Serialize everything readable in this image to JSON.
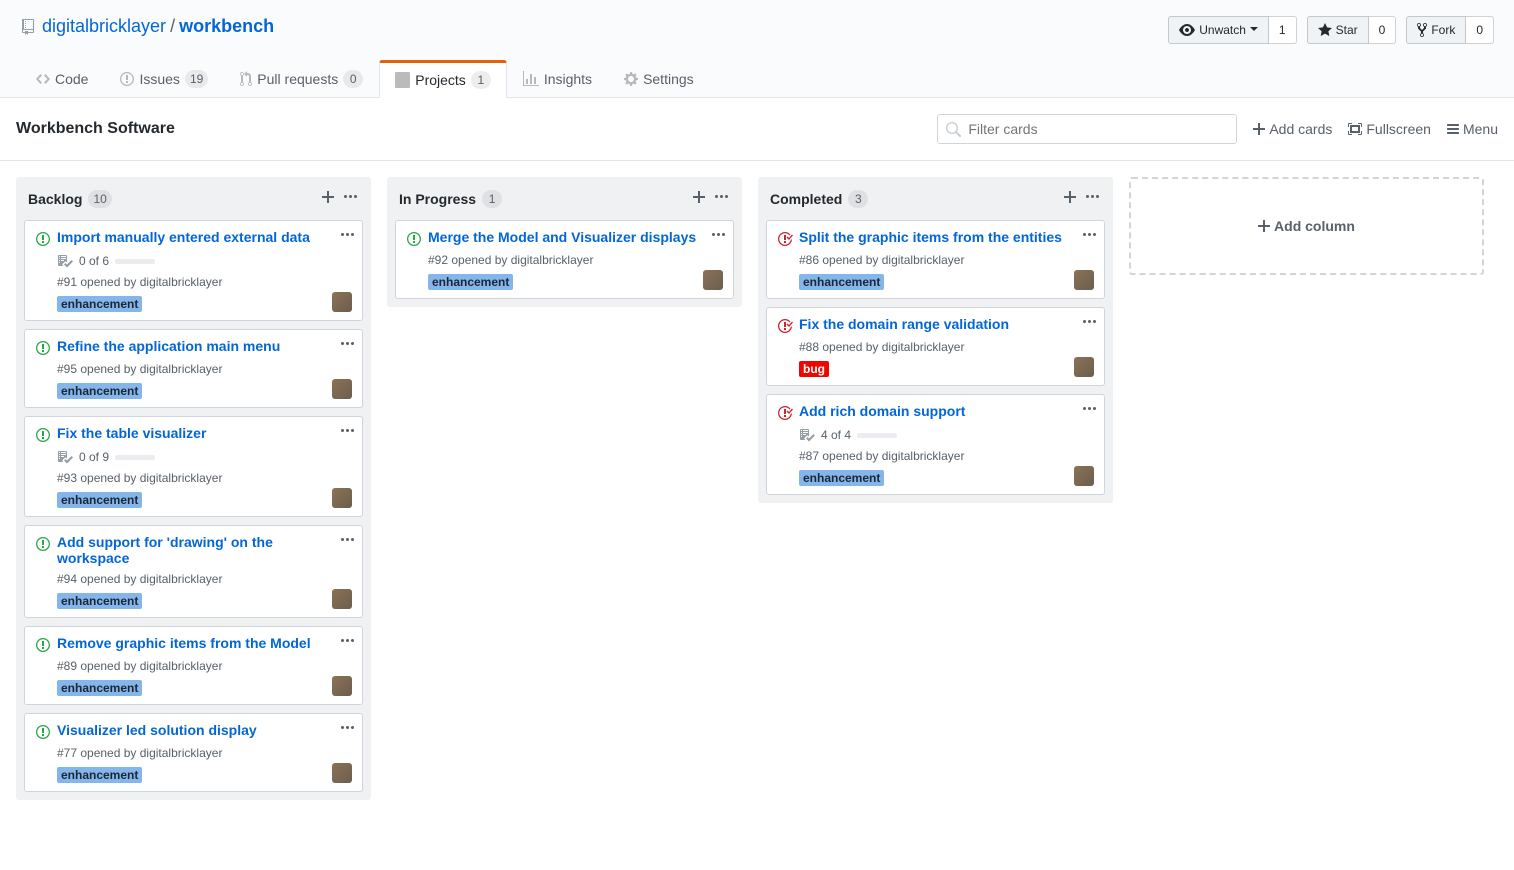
{
  "repo": {
    "owner": "digitalbricklayer",
    "name": "workbench"
  },
  "actions": {
    "watch": {
      "label": "Unwatch",
      "count": "1"
    },
    "star": {
      "label": "Star",
      "count": "0"
    },
    "fork": {
      "label": "Fork",
      "count": "0"
    }
  },
  "nav": {
    "code": "Code",
    "issues": {
      "label": "Issues",
      "count": "19"
    },
    "pulls": {
      "label": "Pull requests",
      "count": "0"
    },
    "projects": {
      "label": "Projects",
      "count": "1"
    },
    "insights": "Insights",
    "settings": "Settings"
  },
  "project": {
    "title": "Workbench Software",
    "filter_placeholder": "Filter cards",
    "add_cards": "Add cards",
    "fullscreen": "Fullscreen",
    "menu": "Menu",
    "add_column": "Add column"
  },
  "labels": {
    "enhancement": {
      "text": "enhancement",
      "bg": "#84b6eb",
      "fg": "#1c2733"
    },
    "bug": {
      "text": "bug",
      "bg": "#ee0701",
      "fg": "#fff"
    }
  },
  "columns": [
    {
      "name": "Backlog",
      "count": "10",
      "cards": [
        {
          "state": "open",
          "title": "Import manually entered external data",
          "progress": {
            "text": "0 of 6",
            "pct": 0
          },
          "meta": "#91 opened by digitalbricklayer",
          "label": "enhancement"
        },
        {
          "state": "open",
          "title": "Refine the application main menu",
          "meta": "#95 opened by digitalbricklayer",
          "label": "enhancement"
        },
        {
          "state": "open",
          "title": "Fix the table visualizer",
          "progress": {
            "text": "0 of 9",
            "pct": 0
          },
          "meta": "#93 opened by digitalbricklayer",
          "label": "enhancement"
        },
        {
          "state": "open",
          "title": "Add support for 'drawing' on the workspace",
          "meta": "#94 opened by digitalbricklayer",
          "label": "enhancement"
        },
        {
          "state": "open",
          "title": "Remove graphic items from the Model",
          "meta": "#89 opened by digitalbricklayer",
          "label": "enhancement"
        },
        {
          "state": "open",
          "title": "Visualizer led solution display",
          "meta": "#77 opened by digitalbricklayer",
          "label": "enhancement"
        }
      ]
    },
    {
      "name": "In Progress",
      "count": "1",
      "cards": [
        {
          "state": "open",
          "title": "Merge the Model and Visualizer displays",
          "meta": "#92 opened by digitalbricklayer",
          "label": "enhancement"
        }
      ]
    },
    {
      "name": "Completed",
      "count": "3",
      "cards": [
        {
          "state": "closed",
          "title": "Split the graphic items from the entities",
          "meta": "#86 opened by digitalbricklayer",
          "label": "enhancement"
        },
        {
          "state": "closed",
          "title": "Fix the domain range validation",
          "meta": "#88 opened by digitalbricklayer",
          "label": "bug"
        },
        {
          "state": "closed",
          "title": "Add rich domain support",
          "progress": {
            "text": "4 of 4",
            "pct": 100
          },
          "meta": "#87 opened by digitalbricklayer",
          "label": "enhancement"
        }
      ]
    }
  ]
}
